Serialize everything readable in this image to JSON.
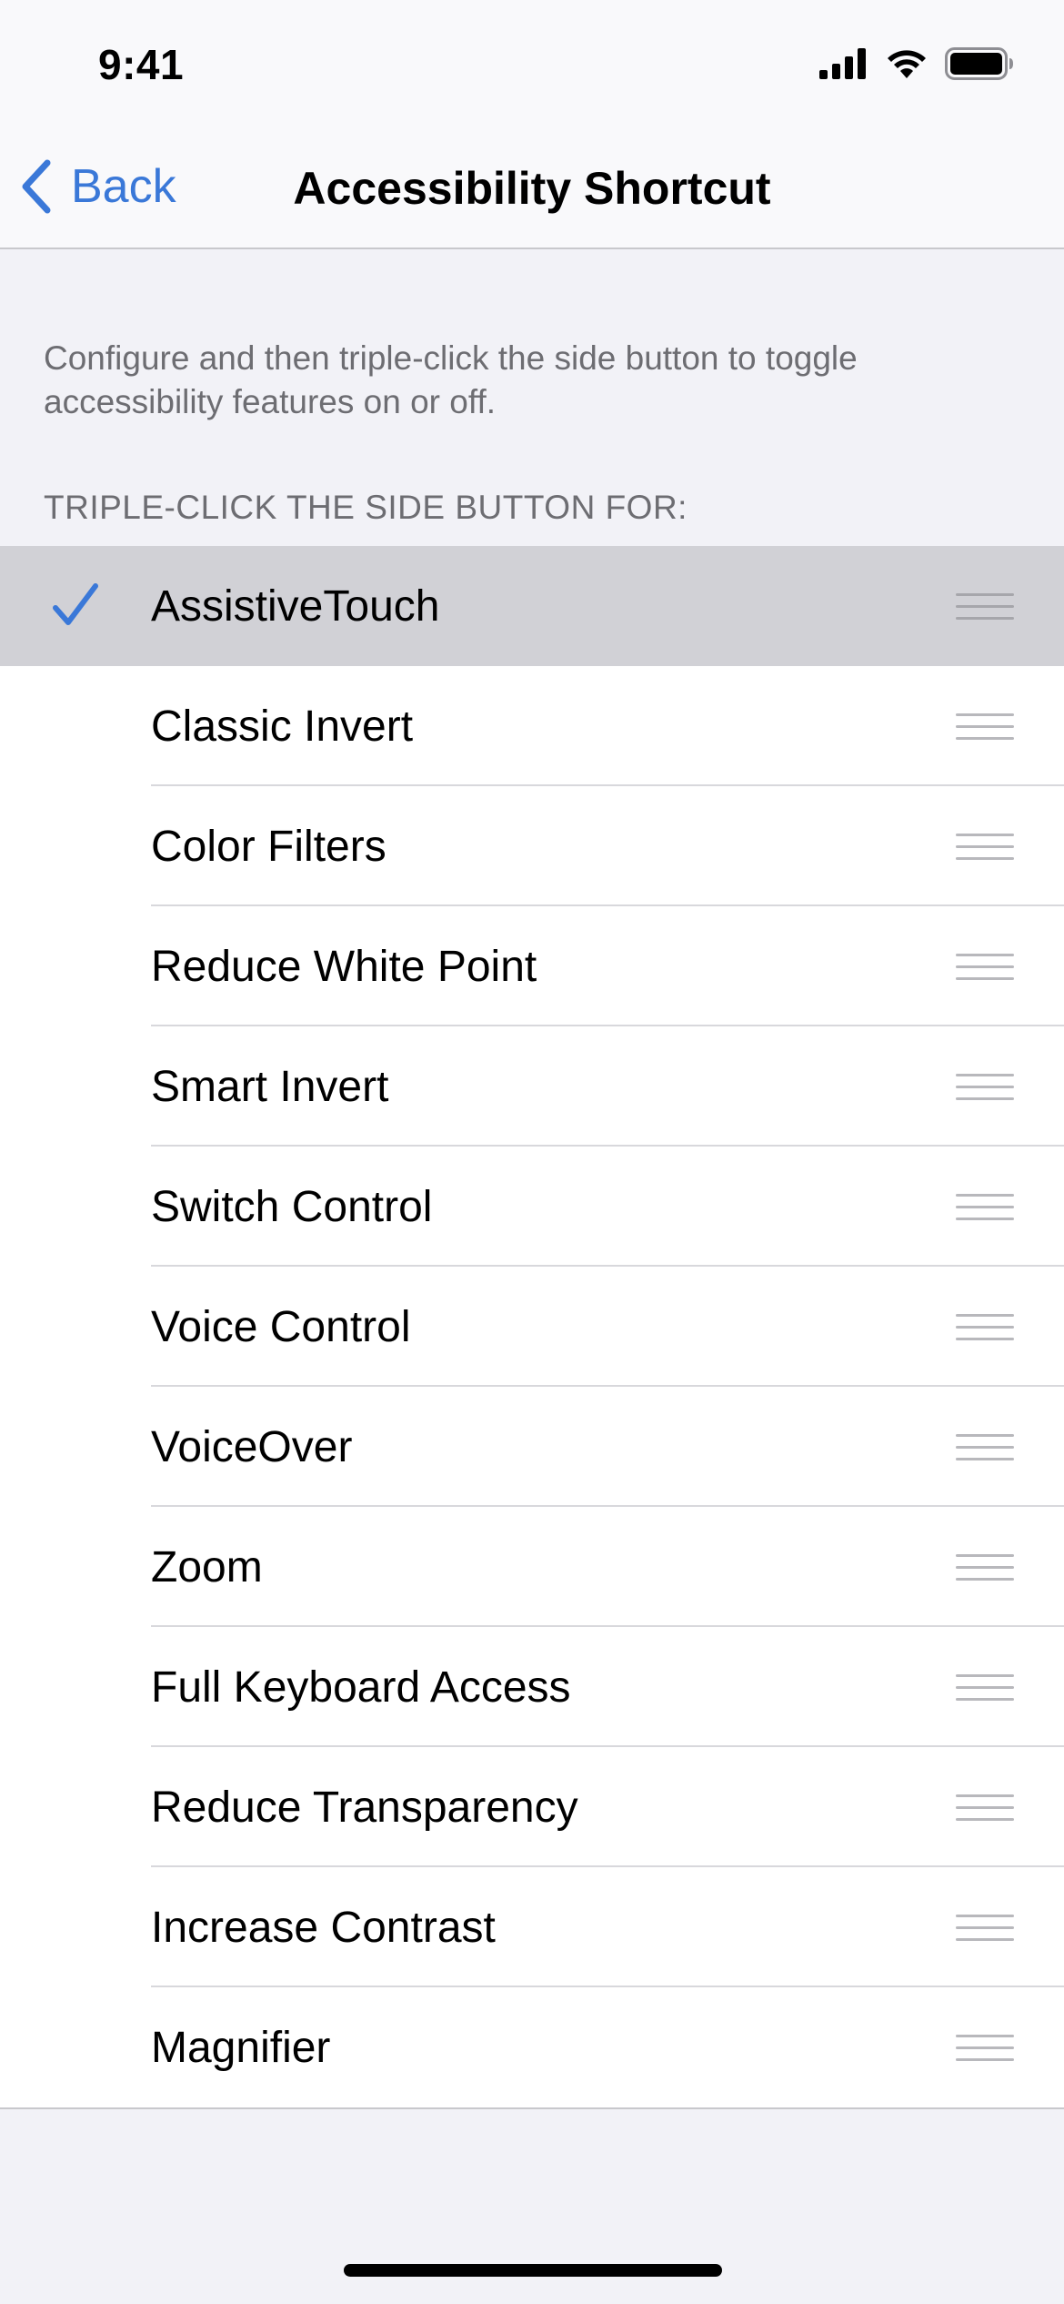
{
  "status_bar": {
    "time": "9:41",
    "icons": [
      "cellular-signal-icon",
      "wifi-icon",
      "battery-icon"
    ]
  },
  "nav": {
    "back_label": "Back",
    "title": "Accessibility Shortcut"
  },
  "description": "Configure and then triple-click the side button to toggle accessibility features on or off.",
  "section_header": "TRIPLE-CLICK THE SIDE BUTTON FOR:",
  "items": [
    {
      "label": "AssistiveTouch",
      "checked": true
    },
    {
      "label": "Classic Invert",
      "checked": false
    },
    {
      "label": "Color Filters",
      "checked": false
    },
    {
      "label": "Reduce White Point",
      "checked": false
    },
    {
      "label": "Smart Invert",
      "checked": false
    },
    {
      "label": "Switch Control",
      "checked": false
    },
    {
      "label": "Voice Control",
      "checked": false
    },
    {
      "label": "VoiceOver",
      "checked": false
    },
    {
      "label": "Zoom",
      "checked": false
    },
    {
      "label": "Full Keyboard Access",
      "checked": false
    },
    {
      "label": "Reduce Transparency",
      "checked": false
    },
    {
      "label": "Increase Contrast",
      "checked": false
    },
    {
      "label": "Magnifier",
      "checked": false
    }
  ],
  "colors": {
    "accent": "#3A78D8",
    "background": "#F2F2F7",
    "highlight": "#D1D1D6",
    "secondary_text": "#6D6D72"
  }
}
